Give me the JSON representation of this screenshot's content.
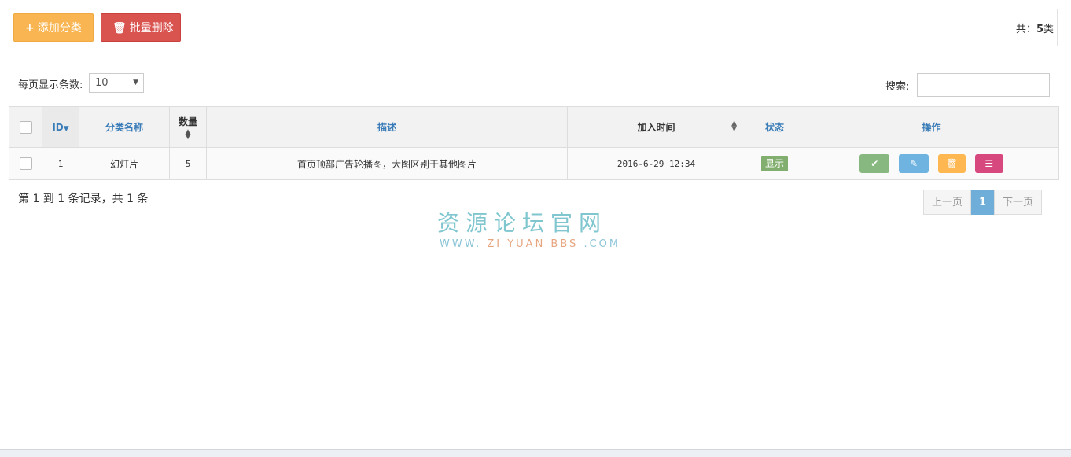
{
  "toolbar": {
    "add_label": "添加分类",
    "add_icon": "plus-icon",
    "delete_label": "批量删除",
    "delete_icon": "trash-icon",
    "total_prefix": "共：",
    "total_count": "5",
    "total_suffix": "类"
  },
  "controls": {
    "perpage_label": "每页显示条数:",
    "perpage_value": "10",
    "search_label": "搜索:",
    "search_value": ""
  },
  "table": {
    "headers": {
      "id": "ID",
      "name": "分类名称",
      "count": "数量",
      "desc": "描述",
      "time": "加入时间",
      "status": "状态",
      "ops": "操作"
    },
    "rows": [
      {
        "id": "1",
        "name": "幻灯片",
        "count": "5",
        "desc": "首页顶部广告轮播图，大图区别于其他图片",
        "time": "2016-6-29 12:34",
        "status": "显示"
      }
    ]
  },
  "footer": {
    "records": "第 1 到 1 条记录，共 1 条",
    "prev": "上一页",
    "current": "1",
    "next": "下一页"
  },
  "watermark": {
    "cn": "资源论坛官网",
    "en_left": "WWW.",
    "en_mid": "ZI YUAN BBS",
    "en_right": ".COM"
  },
  "colors": {
    "add_button": "#f8b551",
    "delete_button": "#d9534f",
    "status_badge": "#82af6f",
    "pager_active": "#6faed9",
    "header_text": "#3a7cb8"
  }
}
